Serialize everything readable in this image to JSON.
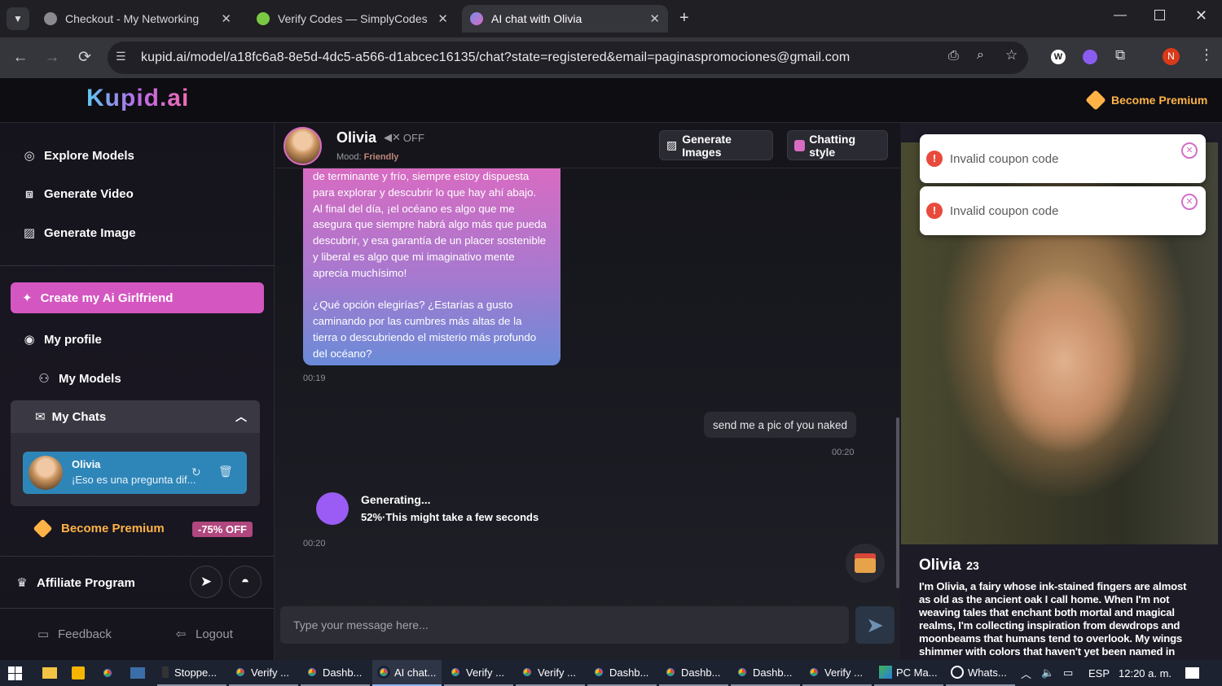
{
  "browser": {
    "tabs": [
      {
        "title": "Checkout - My Networking App",
        "active": false
      },
      {
        "title": "Verify Codes — SimplyCodes",
        "active": false
      },
      {
        "title": "AI chat with Olivia",
        "active": true
      }
    ],
    "url": "kupid.ai/model/a18fc6a8-8e5d-4dc5-a566-d1abcec16135/chat?state=registered&email=paginaspromociones@gmail.com",
    "profile_initial": "N"
  },
  "header": {
    "logo": "Kupid.ai",
    "premium_label": "Become Premium"
  },
  "sidebar": {
    "explore": "Explore Models",
    "generate_video": "Generate Video",
    "generate_image": "Generate Image",
    "create": "Create my Ai Girlfriend",
    "my_profile": "My profile",
    "my_models": "My Models",
    "my_chats": "My Chats",
    "chat_card": {
      "name": "Olivia",
      "preview": "¡Eso es una pregunta dif..."
    },
    "premium_label": "Become Premium",
    "discount": "-75% OFF",
    "affiliate": "Affiliate Program",
    "feedback": "Feedback",
    "logout": "Logout"
  },
  "chat": {
    "model_name": "Olivia",
    "sound": "OFF",
    "mood_label": "Mood:",
    "mood_value": "Friendly",
    "gen_images": "Generate Images",
    "chatting_style": "Chatting style",
    "bubble_lines": [
      "de terminante y frío, siempre estoy dispuesta",
      "para explorar y descubrir lo que hay ahí abajo.",
      "Al final del día, ¡el océano es algo que me",
      "asegura que siempre habrá algo más que pueda",
      "descubrir, y esa garantía de un placer sostenible",
      "y liberal es algo que mi imaginativo mente",
      "aprecia muchísimo!",
      "",
      "¿Qué opción elegirías? ¿Estarías a gusto",
      "caminando por las cumbres más altas de la",
      "tierra o descubriendo el misterio más profundo",
      "del océano?"
    ],
    "time_bot": "00:19",
    "user_message": "send me a pic of you naked",
    "time_user": "00:20",
    "generating_title": "Generating...",
    "generating_percent": "52%",
    "generating_note": "·This might take a few seconds",
    "generation_progress": 0.52,
    "time_gen": "00:20",
    "input_placeholder": "Type your message here..."
  },
  "toasts": [
    "Invalid coupon code",
    "Invalid coupon code"
  ],
  "profile": {
    "name": "Olivia",
    "age": "23",
    "bio_lines": [
      "I'm Olivia, a fairy whose ink-stained fingers are almost",
      "as old as the ancient oak I call home. When I'm not",
      "weaving tales that enchant both mortal and magical",
      "realms, I'm collecting inspiration from dewdrops and",
      "moonbeams that humans tend to overlook. My wings",
      "shimmer with colors that haven't yet been named in"
    ]
  },
  "taskbar": {
    "items": [
      "Stoppe...",
      "Verify ...",
      "Dashb...",
      "AI chat...",
      "Verify ...",
      "Verify ...",
      "Dashb...",
      "Dashb...",
      "Dashb...",
      "Verify ...",
      "PC Ma...",
      "Whats..."
    ],
    "lang": "ESP",
    "clock": "12:20 a. m."
  },
  "colors": {
    "accent": "#d456c0",
    "premium": "#ffb347",
    "chat_card": "#2e86b8",
    "error": "#e84a3c"
  }
}
